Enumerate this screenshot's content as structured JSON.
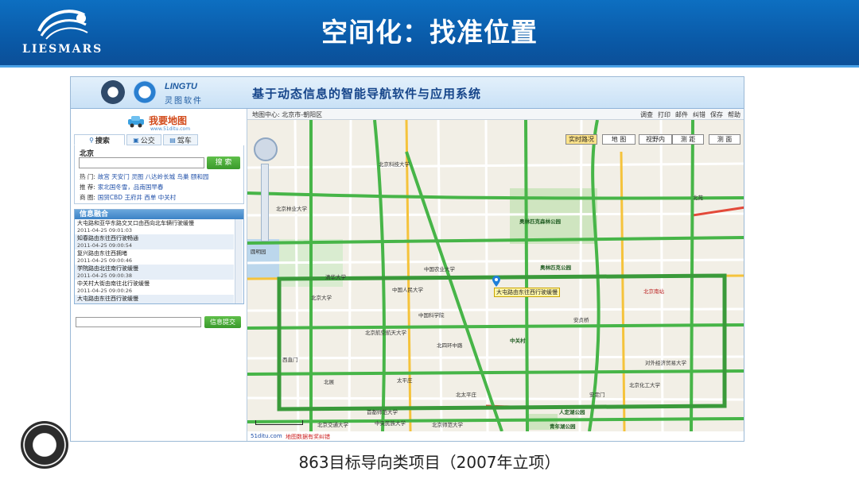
{
  "slide": {
    "title": "空间化：找准位置",
    "logo_text": "LIESMARS",
    "caption": "863目标导向类项目（2007年立项）"
  },
  "app": {
    "brand": "LINGTU",
    "brand_sub": "灵图软件",
    "title": "基于动态信息的智能导航软件与应用系统"
  },
  "left_panel": {
    "brand": "我要地图",
    "brand_url": "www.51ditu.com",
    "tabs": [
      "搜索",
      "公交",
      "驾车"
    ],
    "city": "北京",
    "search_button": "搜 索",
    "hot_label": "热 门:",
    "hot_links": "故宫 天安门 灵图 八达岭长城 鸟巢 颐和园",
    "recommend_label": "推 荐:",
    "recommend_links": "家北国冬雪，品南国早春",
    "business_label": "商 圈:",
    "business_links": "国贸CBD 王府井 西单 中关村",
    "news_title": "信息融合",
    "news": [
      {
        "text": "大屯路和亚华东路交叉口由西向北车辆行驶缓慢",
        "time": "2011-04-25 09:01:03"
      },
      {
        "text": "知春路由东往西行驶畅通",
        "time": "2011-04-25 09:00:54"
      },
      {
        "text": "复兴路由东往西拥堵",
        "time": "2011-04-25 09:00:46"
      },
      {
        "text": "学院路由北往南行驶缓慢",
        "time": "2011-04-25 09:00:38"
      },
      {
        "text": "中关村大街由南往北行驶缓慢",
        "time": "2011-04-25 09:00:26"
      },
      {
        "text": "大屯路由东往西行驶缓慢",
        "time": ""
      }
    ],
    "feedback_button": "信息提交"
  },
  "map": {
    "center_label": "地图中心: 北京市-朝阳区",
    "toolbar_links": [
      "调查",
      "打印",
      "邮件",
      "纠错",
      "保存",
      "帮助"
    ],
    "buttons": {
      "traffic": "实时路况",
      "mode": "地 图",
      "view": "视野内",
      "measure": "测 距",
      "surface": "测 面"
    },
    "pin_label": "大屯路由东往西行驶缓慢",
    "places": {
      "p1": "北京科技大学",
      "p2": "奥林匹克森林公园",
      "p3": "奥林匹克公园",
      "p4": "中国农业大学",
      "p5": "清华大学",
      "p6": "北京大学",
      "p7": "中国人民大学",
      "p8": "北京航空航天大学",
      "p9": "中国科学院",
      "p10": "中关村",
      "p11": "北四环中路",
      "p12": "北京南站",
      "p13": "首都师范大学",
      "p14": "中央民族大学",
      "p15": "北京师范大学",
      "p16": "北京交通大学",
      "p17": "人定湖公园",
      "p18": "青年湖公园",
      "p19": "对外经济贸易大学",
      "p20": "安贞桥",
      "p21": "北京林业大学",
      "p22": "圆明园",
      "p23": "北京化工大学",
      "p24": "太平庄",
      "p25": "北太平庄",
      "p26": "西直门",
      "p27": "安定门",
      "p28": "北苑",
      "p29": "北展"
    },
    "footer_url": "51ditu.com",
    "footer_notice": "地图数据有奖纠错"
  }
}
